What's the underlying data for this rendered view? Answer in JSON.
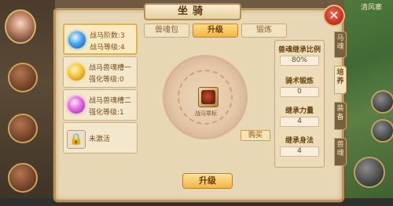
{
  "window": {
    "title": "坐骑",
    "close_label": "✕"
  },
  "tabs": [
    {
      "label": "兽魂包",
      "active": false
    },
    {
      "label": "升级",
      "active": true
    },
    {
      "label": "锻炼",
      "active": false
    }
  ],
  "list": [
    {
      "line1": "战马阶数:3",
      "line2": "战马等级:4",
      "gem": "blue-gem-icon",
      "active": true
    },
    {
      "line1": "战马兽魂槽一",
      "line2": "强化等级:0",
      "gem": "gold-gem-icon",
      "active": false
    },
    {
      "line1": "战马兽魂槽二",
      "line2": "强化等级:1",
      "gem": "pink-gem-icon",
      "active": false
    },
    {
      "line1": "未激活",
      "line2": "",
      "gem": "lock-icon",
      "active": false
    }
  ],
  "center": {
    "slot_label": "战马章标",
    "buy_label": "购买",
    "upgrade_label": "升级"
  },
  "stats": [
    {
      "label": "兽魂继承比例",
      "value": "80%"
    },
    {
      "label": "骑术锻炼",
      "value": "0"
    },
    {
      "label": "继承力量",
      "value": "4"
    },
    {
      "label": "继承身法",
      "value": "4"
    }
  ],
  "side_tabs": [
    {
      "label": "马魂",
      "active": false
    },
    {
      "label": "培养",
      "active": true
    },
    {
      "label": "装备",
      "active": false
    },
    {
      "label": "兽魂",
      "active": false
    }
  ],
  "hud": {
    "minimap_label": "清风寨"
  },
  "colors": {
    "accent": "#f1b441",
    "panel": "#e8d7b4",
    "close": "#c2311e"
  }
}
